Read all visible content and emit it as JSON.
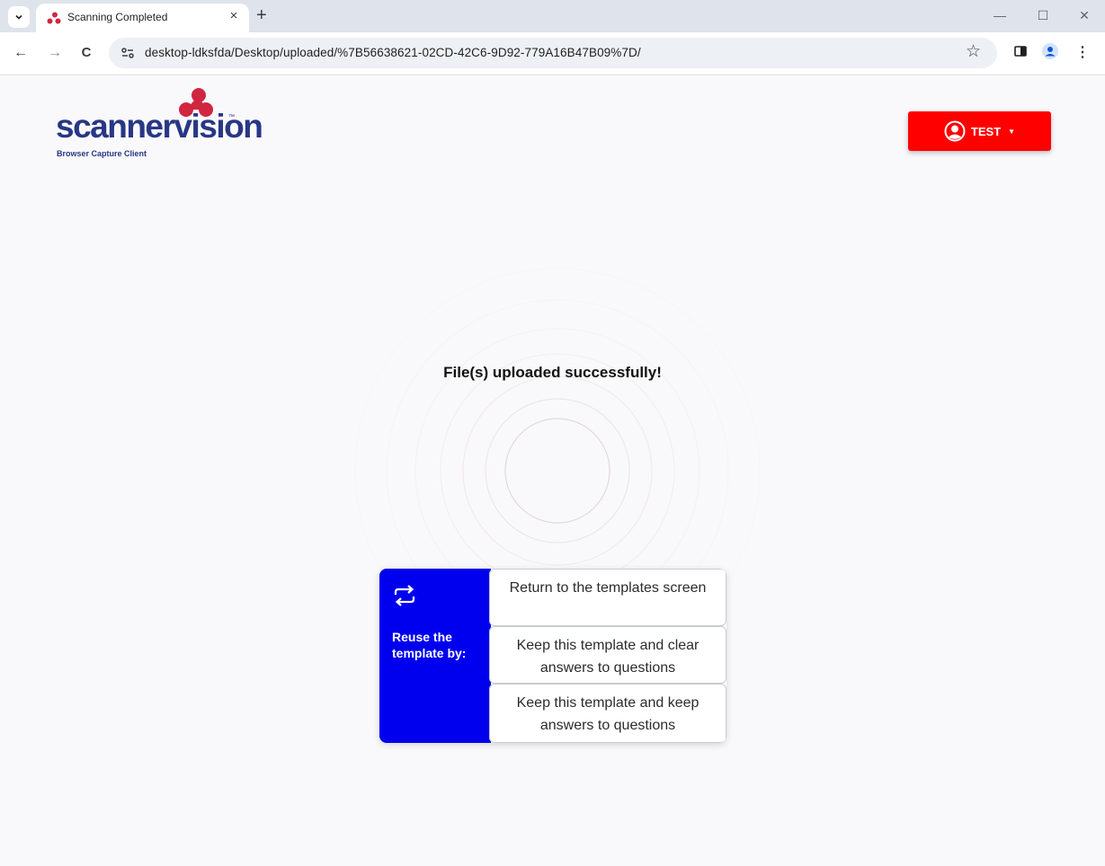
{
  "browser": {
    "tab_title": "Scanning Completed",
    "url": "desktop-ldksfda/Desktop/uploaded/%7B56638621-02CD-42C6-9D92-779A16B47B09%7D/",
    "close_glyph": "×",
    "new_tab_glyph": "+",
    "back_glyph": "←",
    "forward_glyph": "→",
    "reload_glyph": "C",
    "star_glyph": "☆",
    "menu_glyph": "⋮",
    "minimize_glyph": "—",
    "maximize_glyph": "☐",
    "window_close_glyph": "✕"
  },
  "header": {
    "logo_word": "scannervision",
    "logo_tm": "™",
    "logo_subtitle": "Browser Capture Client",
    "user_label": "TEST",
    "user_caret": "▼",
    "brand_red": "#fe0000",
    "brand_navy": "#283785"
  },
  "main": {
    "success_message": "File(s) uploaded successfully!",
    "reuse": {
      "title": "Reuse the template by:",
      "accent": "#0000ee",
      "options": [
        "Return to the templates screen",
        "Keep this template and clear answers to questions",
        "Keep this template and keep answers to questions"
      ]
    }
  },
  "icons": [
    "chevron-down-icon",
    "favicon-icon",
    "close-icon",
    "plus-icon",
    "back-icon",
    "forward-icon",
    "reload-icon",
    "site-info-icon",
    "star-icon",
    "side-panel-icon",
    "profile-icon",
    "menu-icon",
    "user-circle-icon",
    "repeat-icon"
  ]
}
